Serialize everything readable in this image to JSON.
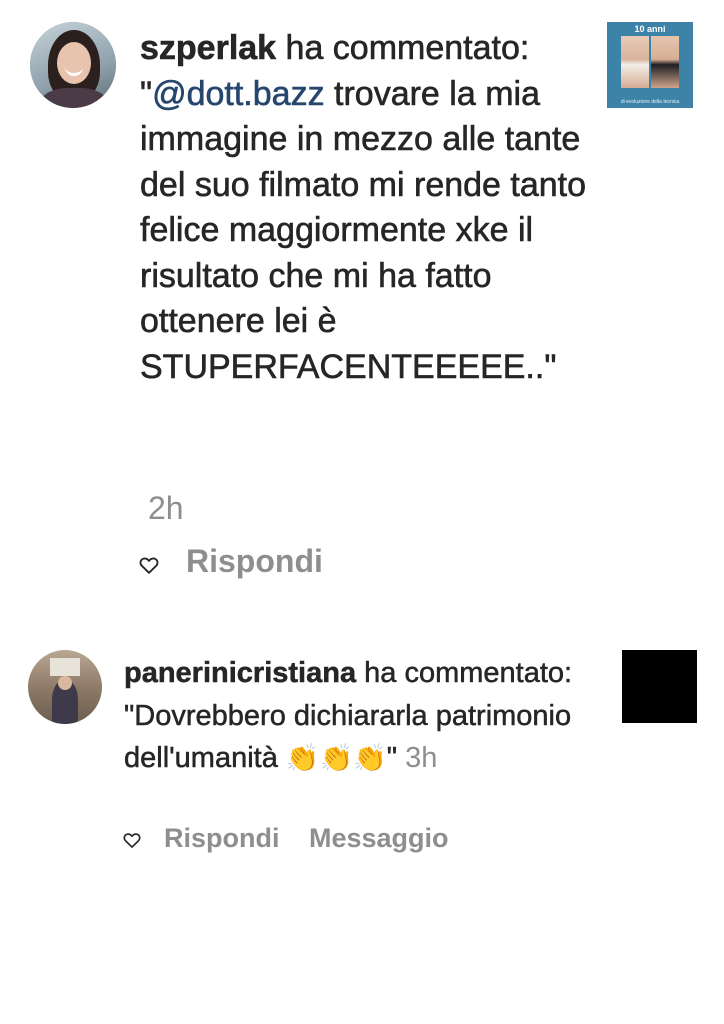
{
  "notifications": [
    {
      "username": "szperlak",
      "action_text": " ha commentato: ",
      "quote_open": "\"",
      "mention": "@dott.bazz",
      "comment": " trovare la mia immagine in mezzo alle tante del suo filmato mi rende tanto felice maggiormente xke il risultato che mi ha fatto ottenere lei è STUPERFACENTEEEEE..",
      "quote_close": "\"",
      "time": "2h",
      "reply_label": "Rispondi",
      "thumbnail": {
        "title": "10 anni",
        "subtitle": "di evoluzione della tecnica"
      }
    },
    {
      "username": "panerinicristiana",
      "action_text": " ha commentato: ",
      "comment": "\"Dovrebbero dichiararla patrimonio dell'umanità ",
      "emoji": "👏👏👏",
      "quote_close": "\"",
      "time": "3h",
      "reply_label": "Rispondi",
      "message_label": "Messaggio"
    }
  ],
  "icons": {
    "heart": "heart-outline-icon"
  },
  "colors": {
    "text": "#262626",
    "muted": "#8e8e8e",
    "mention": "#27466e",
    "thumb_bg": "#3d83a8"
  }
}
